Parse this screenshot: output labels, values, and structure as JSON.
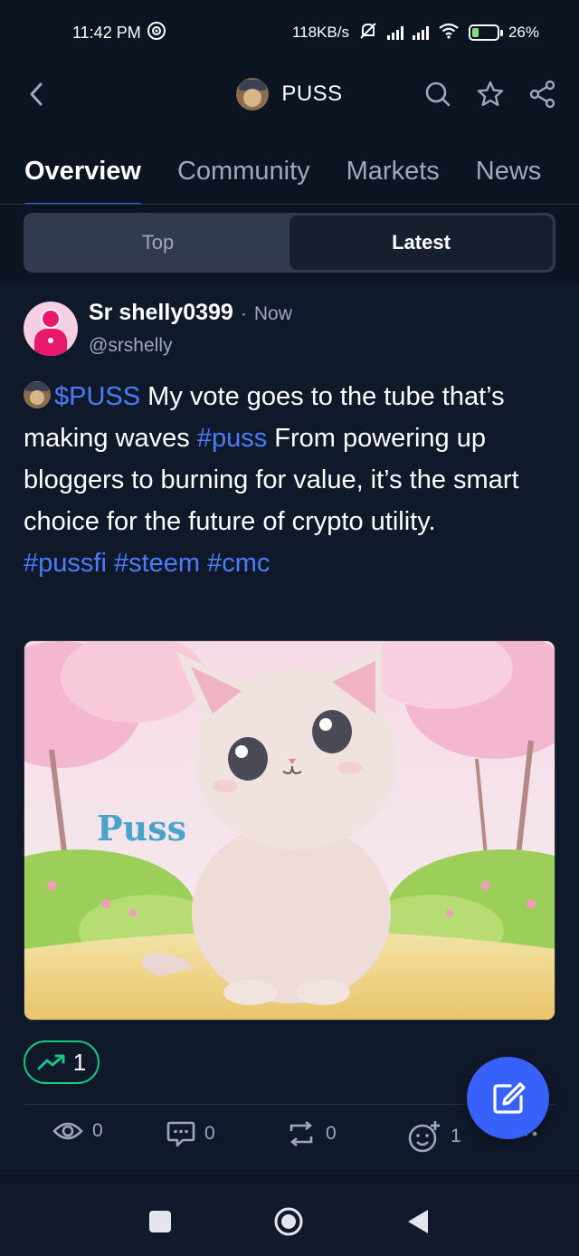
{
  "status_bar": {
    "time": "11:42 PM",
    "net_speed": "118KB/s",
    "battery": "26",
    "battery_level": 0.26
  },
  "header": {
    "title": "PUSS",
    "icons": [
      "back-icon",
      "search-icon",
      "star-icon",
      "share-icon"
    ]
  },
  "tabs": [
    {
      "label": "Overview",
      "active": true
    },
    {
      "label": "Community",
      "active": false
    },
    {
      "label": "Markets",
      "active": false
    },
    {
      "label": "News",
      "active": false
    }
  ],
  "segment": {
    "top_label": "Top",
    "latest_label": "Latest",
    "selected": "Latest"
  },
  "post": {
    "author_name": "Sr shelly0399",
    "separator": "·",
    "time": "Now",
    "handle": "@srshelly",
    "body": {
      "cashtag": "$PUSS",
      "text_1": " My vote goes to the tube that’s making waves ",
      "hashtag_1": "#puss",
      "text_2": "  From powering up bloggers to burning for value, it’s the smart choice for the future of crypto utility.",
      "hashtags": "#pussfi #steem #cmc"
    },
    "image": {
      "overlay_text": "Puss",
      "description_icon": "kitten-illustration"
    },
    "trend_reaction_count": "1",
    "actions": {
      "views": "0",
      "comments": "0",
      "reposts": "0",
      "reactions": "1"
    }
  },
  "colors": {
    "background": "#0d1421",
    "post_background": "#10192a",
    "accent": "#3861fb",
    "link": "#4a7cff",
    "positive": "#16c784",
    "muted_text": "#a1a7bb"
  }
}
